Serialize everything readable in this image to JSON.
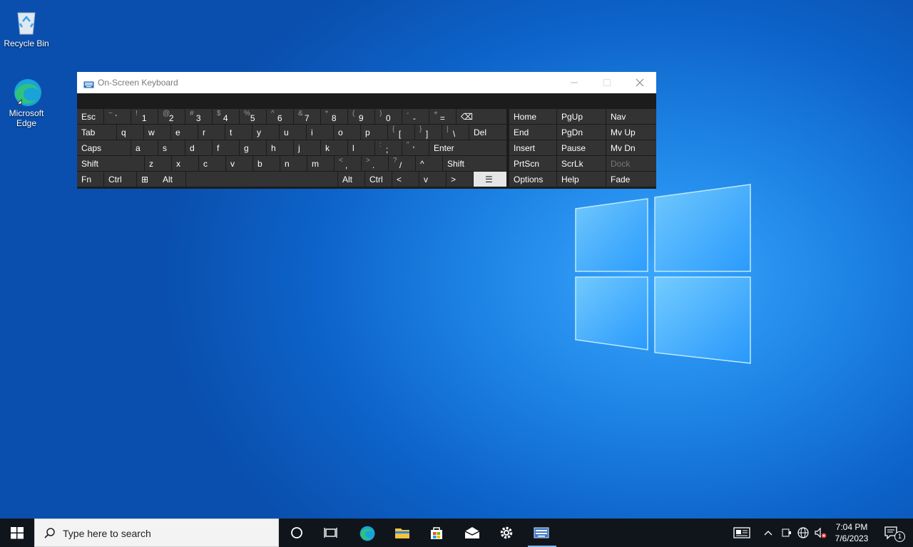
{
  "desktop": {
    "icons": [
      {
        "label": "Recycle Bin"
      },
      {
        "label": "Microsoft Edge"
      }
    ]
  },
  "osk": {
    "title": "On-Screen Keyboard",
    "rows": [
      {
        "keys": [
          {
            "label": "Esc"
          },
          {
            "shift": "~",
            "main": "`"
          },
          {
            "shift": "!",
            "main": "1"
          },
          {
            "shift": "@",
            "main": "2"
          },
          {
            "shift": "#",
            "main": "3"
          },
          {
            "shift": "$",
            "main": "4"
          },
          {
            "shift": "%",
            "main": "5"
          },
          {
            "shift": "^",
            "main": "6"
          },
          {
            "shift": "&",
            "main": "7"
          },
          {
            "shift": "*",
            "main": "8"
          },
          {
            "shift": "(",
            "main": "9"
          },
          {
            "shift": ")",
            "main": "0"
          },
          {
            "shift": "-",
            "main": "-"
          },
          {
            "shift": "+",
            "main": "="
          },
          {
            "label": "⌫"
          }
        ]
      },
      {
        "keys": [
          {
            "label": "Tab"
          },
          {
            "label": "q"
          },
          {
            "label": "w"
          },
          {
            "label": "e"
          },
          {
            "label": "r"
          },
          {
            "label": "t"
          },
          {
            "label": "y"
          },
          {
            "label": "u"
          },
          {
            "label": "i"
          },
          {
            "label": "o"
          },
          {
            "label": "p"
          },
          {
            "shift": "{",
            "main": "["
          },
          {
            "shift": "}",
            "main": "]"
          },
          {
            "shift": "|",
            "main": "\\"
          },
          {
            "label": "Del"
          }
        ]
      },
      {
        "keys": [
          {
            "label": "Caps"
          },
          {
            "label": "a"
          },
          {
            "label": "s"
          },
          {
            "label": "d"
          },
          {
            "label": "f"
          },
          {
            "label": "g"
          },
          {
            "label": "h"
          },
          {
            "label": "j"
          },
          {
            "label": "k"
          },
          {
            "label": "l"
          },
          {
            "shift": ":",
            "main": ";"
          },
          {
            "shift": "\"",
            "main": "'"
          },
          {
            "label": "Enter"
          }
        ]
      },
      {
        "keys": [
          {
            "label": "Shift"
          },
          {
            "label": "z"
          },
          {
            "label": "x"
          },
          {
            "label": "c"
          },
          {
            "label": "v"
          },
          {
            "label": "b"
          },
          {
            "label": "n"
          },
          {
            "label": "m"
          },
          {
            "shift": "<",
            "main": ","
          },
          {
            "shift": ">",
            "main": "."
          },
          {
            "shift": "?",
            "main": "/"
          },
          {
            "label": "^"
          },
          {
            "label": "Shift"
          }
        ]
      },
      {
        "keys": [
          {
            "label": "Fn"
          },
          {
            "label": "Ctrl"
          },
          {
            "label": "⊞"
          },
          {
            "label": "Alt"
          },
          {
            "label": ""
          },
          {
            "label": "Alt"
          },
          {
            "label": "Ctrl"
          },
          {
            "label": "<"
          },
          {
            "label": "v"
          },
          {
            "label": ">"
          },
          {
            "label": "☰"
          }
        ]
      }
    ],
    "nav_keys": [
      [
        "Home",
        "PgUp",
        "Nav"
      ],
      [
        "End",
        "PgDn",
        "Mv Up"
      ],
      [
        "Insert",
        "Pause",
        "Mv Dn"
      ],
      [
        "PrtScn",
        "ScrLk",
        "Dock"
      ],
      [
        "Options",
        "Help",
        "Fade"
      ]
    ]
  },
  "taskbar": {
    "search_placeholder": "Type here to search",
    "clock_time": "7:04 PM",
    "clock_date": "7/6/2023",
    "notification_count": "1"
  }
}
